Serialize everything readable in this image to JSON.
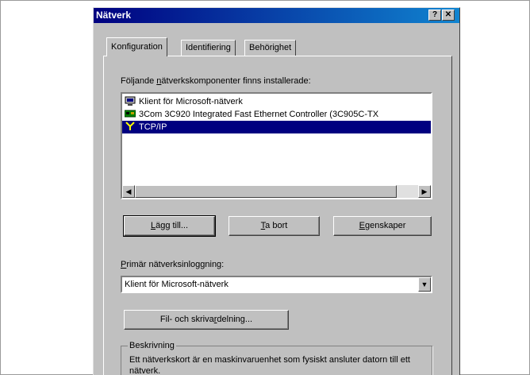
{
  "window": {
    "title": "Nätverk",
    "help_button": "?",
    "close_button": "✕"
  },
  "tabs": [
    {
      "label": "Konfiguration",
      "active": true
    },
    {
      "label": "Identifiering",
      "active": false
    },
    {
      "label": "Behörighet",
      "active": false
    }
  ],
  "components": {
    "label_pre": "Följande ",
    "label_key": "n",
    "label_post": "ätverkskomponenter finns installerade:",
    "items": [
      {
        "label": "Klient för Microsoft-nätverk",
        "icon": "network-client-icon",
        "selected": false
      },
      {
        "label": "3Com 3C920 Integrated Fast Ethernet Controller (3C905C-TX",
        "icon": "network-adapter-icon",
        "selected": false
      },
      {
        "label": "TCP/IP",
        "icon": "protocol-icon",
        "selected": true
      }
    ]
  },
  "buttons": {
    "add": {
      "key": "L",
      "rest": "ägg till..."
    },
    "remove": {
      "key": "T",
      "rest": "a bort"
    },
    "properties": {
      "key": "E",
      "rest": "genskaper"
    }
  },
  "logon": {
    "label_key": "P",
    "label_rest": "rimär nätverksinloggning:",
    "value": "Klient för Microsoft-nätverk"
  },
  "sharing": {
    "pre": "Fil- och skriva",
    "key": "r",
    "post": "delning..."
  },
  "description": {
    "title": "Beskrivning",
    "text": "Ett nätverkskort är en maskinvaruenhet som fysiskt ansluter datorn till ett nätverk."
  }
}
